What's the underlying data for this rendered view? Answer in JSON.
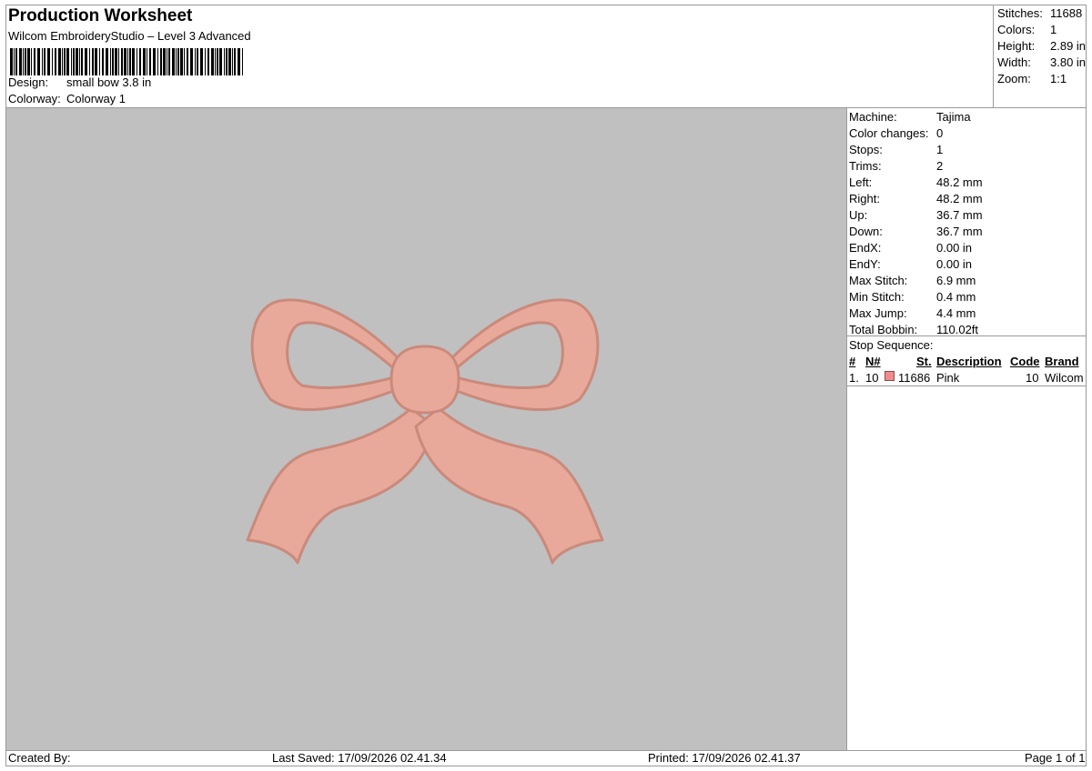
{
  "header": {
    "title": "Production Worksheet",
    "subtitle": "Wilcom EmbroideryStudio – Level 3 Advanced",
    "design_label": "Design:",
    "design_value": "small bow 3.8 in",
    "colorway_label": "Colorway:",
    "colorway_value": "Colorway 1"
  },
  "stats": {
    "stitches_label": "Stitches:",
    "stitches": "11688",
    "colors_label": "Colors:",
    "colors": "1",
    "height_label": "Height:",
    "height": "2.89 in",
    "width_label": "Width:",
    "width": "3.80 in",
    "zoom_label": "Zoom:",
    "zoom": "1:1"
  },
  "machine_info": [
    {
      "label": "Machine:",
      "value": "Tajima"
    },
    {
      "label": "Color changes:",
      "value": "0"
    },
    {
      "label": "Stops:",
      "value": "1"
    },
    {
      "label": "Trims:",
      "value": "2"
    },
    {
      "label": "Left:",
      "value": "48.2 mm"
    },
    {
      "label": "Right:",
      "value": "48.2 mm"
    },
    {
      "label": "Up:",
      "value": "36.7 mm"
    },
    {
      "label": "Down:",
      "value": "36.7 mm"
    },
    {
      "label": "EndX:",
      "value": "0.00 in"
    },
    {
      "label": "EndY:",
      "value": "0.00 in"
    },
    {
      "label": "Max Stitch:",
      "value": "6.9 mm"
    },
    {
      "label": "Min Stitch:",
      "value": "0.4 mm"
    },
    {
      "label": "Max Jump:",
      "value": "4.4 mm"
    },
    {
      "label": "Total Bobbin:",
      "value": "110.02ft"
    }
  ],
  "stop_sequence": {
    "title": "Stop Sequence:",
    "columns": [
      "#",
      "N#",
      "St.",
      "Description",
      "Code",
      "Brand"
    ],
    "rows": [
      {
        "num": "1.",
        "n": "10",
        "swatch_color": "#f08c8c",
        "stitches": "11686",
        "description": "Pink",
        "code": "10",
        "brand": "Wilcom"
      }
    ]
  },
  "design_color": "#e8a99a",
  "footer": {
    "created_by": "Created By:",
    "last_saved": "Last Saved: 17/09/2026 02.41.34",
    "printed": "Printed: 17/09/2026 02.41.37",
    "page": "Page 1 of 1"
  }
}
